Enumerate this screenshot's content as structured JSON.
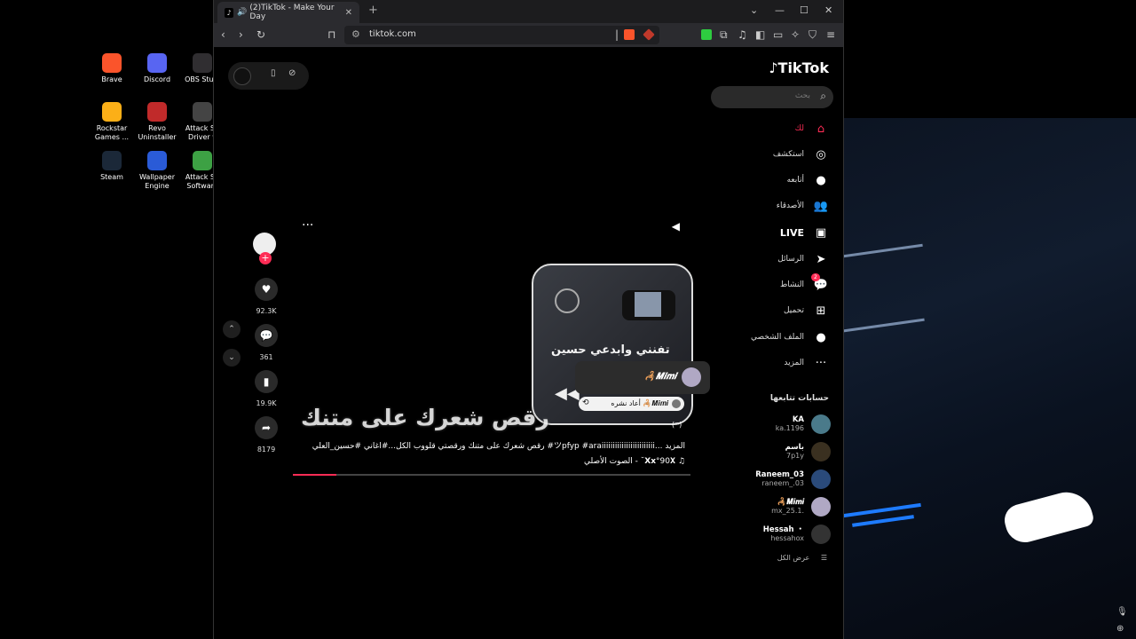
{
  "desktop": {
    "icons": [
      {
        "label": "Brave",
        "color": "#fb542b"
      },
      {
        "label": "Discord",
        "color": "#5865f2"
      },
      {
        "label": "OBS Studi",
        "color": "#302e31"
      },
      {
        "label": "Rockstar Games ...",
        "color": "#fcaf17"
      },
      {
        "label": "Revo Uninstaller",
        "color": "#c02a2a"
      },
      {
        "label": "Attack Sh Driver v",
        "color": "#444444"
      },
      {
        "label": "Steam",
        "color": "#1b2838"
      },
      {
        "label": "Wallpaper Engine",
        "color": "#2a5bd7"
      },
      {
        "label": "Attack Sh Software",
        "color": "#3da144"
      }
    ]
  },
  "browser": {
    "tab_title": "(2)TikTok - Make Your Day",
    "url": "tiktok.com"
  },
  "tiktok": {
    "logo": "TikTok",
    "search_placeholder": "بحث",
    "nav": [
      {
        "label": "لك",
        "icon": "home-icon",
        "glyph": "⌂",
        "active": true
      },
      {
        "label": "استكشف",
        "icon": "compass-icon",
        "glyph": "◎"
      },
      {
        "label": "أتابعه",
        "icon": "following-avatar-icon",
        "glyph": "●"
      },
      {
        "label": "الأصدقاء",
        "icon": "friends-icon",
        "glyph": "👥"
      },
      {
        "label": "LIVE",
        "icon": "live-icon",
        "glyph": "▣"
      },
      {
        "label": "الرسائل",
        "icon": "messages-icon",
        "glyph": "➤"
      },
      {
        "label": "النشاط",
        "icon": "activity-icon",
        "glyph": "💬",
        "badge": "2"
      },
      {
        "label": "تحميل",
        "icon": "upload-icon",
        "glyph": "⊞"
      },
      {
        "label": "الملف الشخصي",
        "icon": "profile-icon",
        "glyph": "●"
      },
      {
        "label": "المزيد",
        "icon": "more-icon",
        "glyph": "···"
      }
    ],
    "following_title": "حسابات تتابعها",
    "following": [
      {
        "name": "KA",
        "handle": "ka.1196",
        "color": "#4a7a8a"
      },
      {
        "name": "باسم",
        "handle": "7p1y",
        "color": "#3a3020"
      },
      {
        "name": "Raneem_03",
        "handle": "raneem_.03",
        "color": "#2a4a7a"
      },
      {
        "name": "🦂𝑴𝒊𝒎𝒊",
        "handle": "mx_25.1.",
        "color": "#b0a8c4"
      },
      {
        "name": "Hessah ・",
        "handle": "hessahox",
        "color": "#333333"
      }
    ],
    "see_all": "عرض الكل",
    "video": {
      "card_text": "تفنني وابدعي حسين",
      "overlay_text": "رقص شعرك على متنك",
      "caption": "رقص شعرك على متنك ورقصتي قلووب الكل...#اغاني #حسين_العلي #ツpfyp #araiiiiiiiiiiiiiiiiiiiiiiii... المزيد",
      "music": "الصوت الأصلي - ˘𝗫𝘅°90𝐗",
      "progress": 0.11,
      "popup_name": "🦂𝑴𝒊𝒎𝒊",
      "repost_label": "أعاد نشره 🦂𝑴𝒊𝒎𝒊",
      "corner_label": "(ᵐ)"
    },
    "stats": {
      "likes": "92.3K",
      "comments": "361",
      "saves": "19.9K",
      "shares": "8179"
    }
  }
}
